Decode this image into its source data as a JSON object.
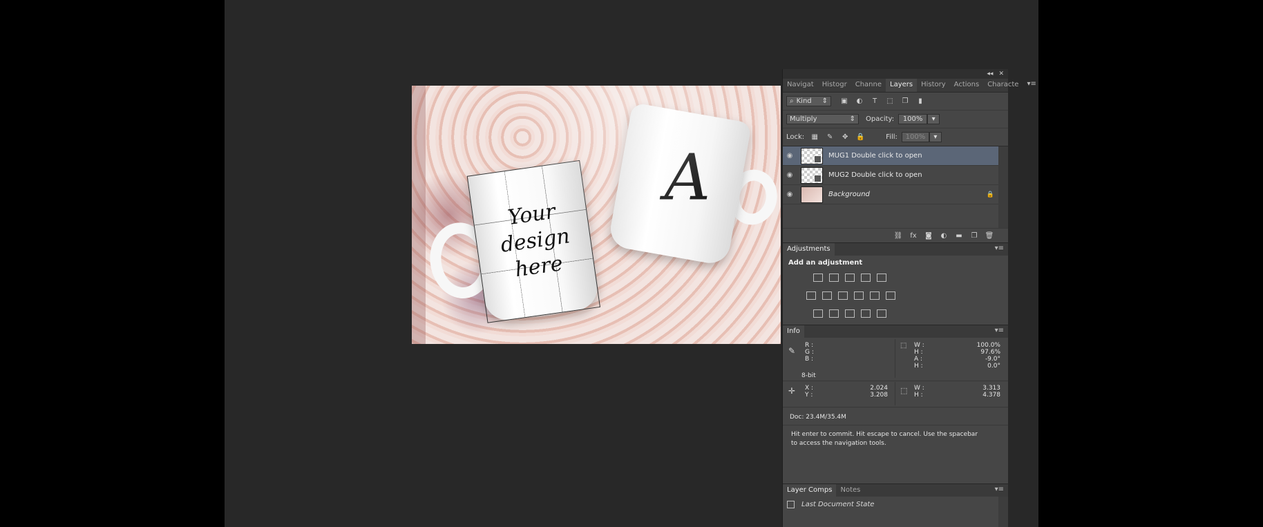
{
  "window": {
    "title": ""
  },
  "canvas": {
    "mug_left_text": [
      "Your",
      "design",
      "here"
    ],
    "mug_right_text": "A"
  },
  "panel_top_controls": {
    "collapse": "◂◂",
    "close": "✕"
  },
  "tabs_top": {
    "items": [
      "Navigat",
      "Histogr",
      "Channe",
      "Layers",
      "History",
      "Actions",
      "Characte"
    ],
    "active": "Layers",
    "menu": "▾≡"
  },
  "layers_panel": {
    "filter_kind": "Kind",
    "blend_mode": "Multiply",
    "opacity_label": "Opacity:",
    "opacity_value": "100%",
    "lock_label": "Lock:",
    "fill_label": "Fill:",
    "fill_value": "100%",
    "layers": [
      {
        "name": "MUG1 Double click to open",
        "selected": true,
        "type": "smart"
      },
      {
        "name": "MUG2 Double click to open",
        "selected": false,
        "type": "smart"
      },
      {
        "name": "Background",
        "selected": false,
        "type": "background"
      }
    ],
    "bottom_icons": [
      "link-icon",
      "fx-icon",
      "mask-icon",
      "adjustment-icon",
      "folder-icon",
      "new-layer-icon",
      "trash-icon"
    ],
    "fx_label": "fx"
  },
  "adjustments": {
    "tab": "Adjustments",
    "heading": "Add an adjustment"
  },
  "info": {
    "tab": "Info",
    "rgb": [
      "R :",
      "G :",
      "B :"
    ],
    "bit": "8-bit",
    "transform": {
      "W": "100.0%",
      "H": "97.6%",
      "A": "-9.0°",
      "H2": "0.0°"
    },
    "xy": {
      "X": "2.024",
      "Y": "3.208"
    },
    "wh": {
      "W": "3.313",
      "H": "4.378"
    },
    "labels": {
      "W": "W :",
      "H": "H :",
      "A": "A :",
      "X": "X :",
      "Y": "Y :"
    },
    "doc": "Doc: 23.4M/35.4M",
    "status": "Hit enter to commit. Hit escape to cancel. Use the spacebar to access the navigation tools."
  },
  "layer_comps": {
    "tabs": [
      "Layer Comps",
      "Notes"
    ],
    "item": "Last Document State"
  }
}
